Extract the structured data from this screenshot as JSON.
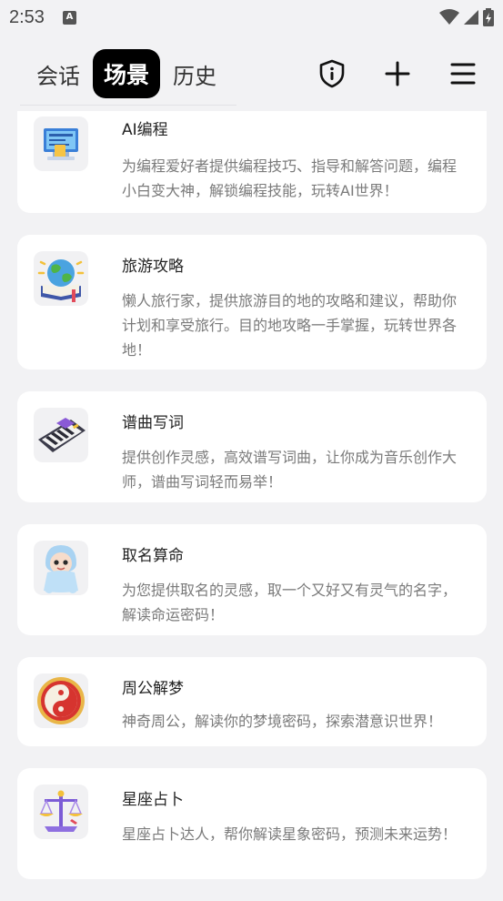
{
  "status": {
    "time": "2:53",
    "notification_badge": "A"
  },
  "header": {
    "tabs": [
      {
        "label": "会话",
        "active": false
      },
      {
        "label": "场景",
        "active": true
      },
      {
        "label": "历史",
        "active": false
      }
    ],
    "actions": [
      "shield-info-icon",
      "plus-icon",
      "menu-icon"
    ]
  },
  "scenes": [
    {
      "title": "AI编程",
      "desc": "为编程爱好者提供编程技巧、指导和解答问题，编程小白变大神，解锁编程技能，玩转AI世界！",
      "icon": "computer-icon"
    },
    {
      "title": "旅游攻略",
      "desc": "懒人旅行家，提供旅游目的地的攻略和建议，帮助你计划和享受旅行。目的地攻略一手掌握，玩转世界各地！",
      "icon": "globe-book-icon"
    },
    {
      "title": "谱曲写词",
      "desc": "提供创作灵感，高效谱写词曲，让你成为音乐创作大师，谱曲写词轻而易举！",
      "icon": "keyboard-icon"
    },
    {
      "title": "取名算命",
      "desc": "为您提供取名的灵感，取一个又好又有灵气的名字，解读命运密码！",
      "icon": "baby-icon"
    },
    {
      "title": "周公解梦",
      "desc": "神奇周公，解读你的梦境密码，探索潜意识世界！",
      "icon": "yin-yang-icon"
    },
    {
      "title": "星座占卜",
      "desc": "星座占卜达人，帮你解读星象密码，预测未来运势！",
      "icon": "scales-icon"
    }
  ]
}
